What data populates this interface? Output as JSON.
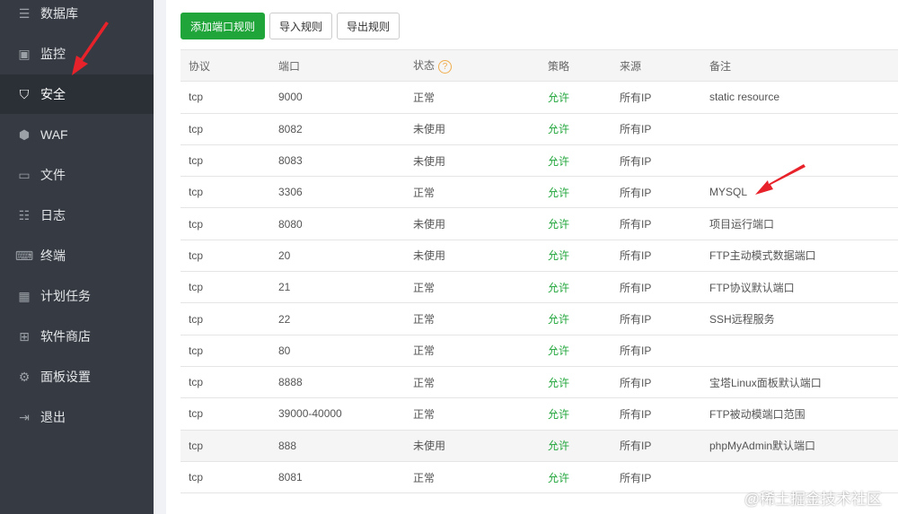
{
  "sidebar": {
    "items": [
      {
        "label": "数据库",
        "icon": "database-icon"
      },
      {
        "label": "监控",
        "icon": "monitor-icon"
      },
      {
        "label": "安全",
        "icon": "shield-check-icon",
        "active": true
      },
      {
        "label": "WAF",
        "icon": "waf-shield-icon"
      },
      {
        "label": "文件",
        "icon": "folder-icon"
      },
      {
        "label": "日志",
        "icon": "log-icon"
      },
      {
        "label": "终端",
        "icon": "terminal-icon"
      },
      {
        "label": "计划任务",
        "icon": "calendar-icon"
      },
      {
        "label": "软件商店",
        "icon": "grid-icon"
      },
      {
        "label": "面板设置",
        "icon": "gear-icon"
      },
      {
        "label": "退出",
        "icon": "logout-icon"
      }
    ]
  },
  "toolbar": {
    "add": "添加端口规则",
    "import": "导入规则",
    "export": "导出规则"
  },
  "table": {
    "headers": [
      "协议",
      "端口",
      "状态",
      "策略",
      "来源",
      "备注"
    ],
    "status_help": "?",
    "rows": [
      [
        "tcp",
        "9000",
        "正常",
        "允许",
        "所有IP",
        "static resource"
      ],
      [
        "tcp",
        "8082",
        "未使用",
        "允许",
        "所有IP",
        ""
      ],
      [
        "tcp",
        "8083",
        "未使用",
        "允许",
        "所有IP",
        ""
      ],
      [
        "tcp",
        "3306",
        "正常",
        "允许",
        "所有IP",
        "MYSQL"
      ],
      [
        "tcp",
        "8080",
        "未使用",
        "允许",
        "所有IP",
        "项目运行端口"
      ],
      [
        "tcp",
        "20",
        "未使用",
        "允许",
        "所有IP",
        "FTP主动模式数据端口"
      ],
      [
        "tcp",
        "21",
        "正常",
        "允许",
        "所有IP",
        "FTP协议默认端口"
      ],
      [
        "tcp",
        "22",
        "正常",
        "允许",
        "所有IP",
        "SSH远程服务"
      ],
      [
        "tcp",
        "80",
        "正常",
        "允许",
        "所有IP",
        ""
      ],
      [
        "tcp",
        "8888",
        "正常",
        "允许",
        "所有IP",
        "宝塔Linux面板默认端口"
      ],
      [
        "tcp",
        "39000-40000",
        "正常",
        "允许",
        "所有IP",
        "FTP被动模端口范围"
      ],
      [
        "tcp",
        "888",
        "未使用",
        "允许",
        "所有IP",
        "phpMyAdmin默认端口"
      ],
      [
        "tcp",
        "8081",
        "正常",
        "允许",
        "所有IP",
        ""
      ]
    ]
  },
  "watermark": "@稀土掘金技术社区",
  "colors": {
    "accent": "#20a53a",
    "sidebar": "#363b43",
    "annotation": "#e8222a"
  }
}
